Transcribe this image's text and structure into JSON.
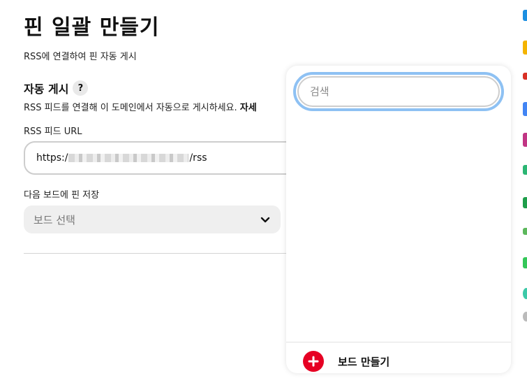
{
  "page": {
    "title": "핀 일괄 만들기",
    "subtitle": "RSS에 연결하여 핀 자동 게시"
  },
  "auto_post": {
    "heading": "자동 게시",
    "help_label": "?",
    "description": "RSS 피드를 연결해 이 도메인에서 자동으로 게시하세요.",
    "more_link": "자세"
  },
  "rss": {
    "label": "RSS 피드 URL",
    "value_prefix": "https:/",
    "value_suffix": "/rss"
  },
  "board": {
    "label": "다음 보드에 핀 저장",
    "placeholder": "보드 선택"
  },
  "popover": {
    "search_placeholder": "검색",
    "create_board_label": "보드 만들기"
  },
  "colors": {
    "accent_red": "#e60023",
    "focus_ring": "#8ec1f3"
  },
  "right_rail": {
    "icons": [
      "app-icon-blue",
      "app-icon-yellow",
      "app-icon-red",
      "app-icon-blue-2",
      "instagram-icon",
      "app-icon-green",
      "app-icon-green-2",
      "app-icon-green-3",
      "app-icon-green-4",
      "app-icon-teal",
      "app-icon-grey"
    ]
  }
}
